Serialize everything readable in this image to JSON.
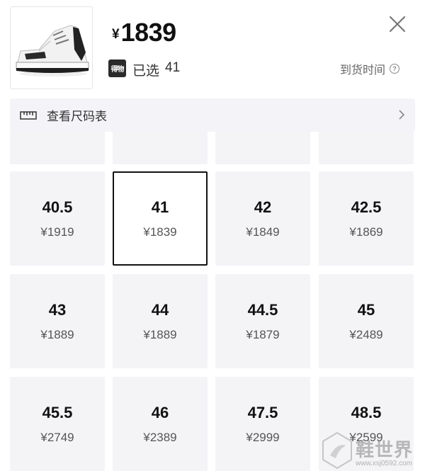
{
  "product": {
    "currency": "¥",
    "price": "1839",
    "badge": "得物",
    "selected_label": "已选",
    "selected_size": "41",
    "arrival_label": "到货时间"
  },
  "size_chart": {
    "label": "查看尺码表"
  },
  "sizes": [
    {
      "size": "40.5",
      "price": "¥1919"
    },
    {
      "size": "41",
      "price": "¥1839",
      "selected": true
    },
    {
      "size": "42",
      "price": "¥1849"
    },
    {
      "size": "42.5",
      "price": "¥1869"
    },
    {
      "size": "43",
      "price": "¥1889"
    },
    {
      "size": "44",
      "price": "¥1889"
    },
    {
      "size": "44.5",
      "price": "¥1879"
    },
    {
      "size": "45",
      "price": "¥2489"
    },
    {
      "size": "45.5",
      "price": "¥2749"
    },
    {
      "size": "46",
      "price": "¥2389"
    },
    {
      "size": "47.5",
      "price": "¥2999"
    },
    {
      "size": "48.5",
      "price": "¥2599"
    }
  ],
  "watermark": {
    "text": "鞋世界",
    "url": "www.xsj0592.com"
  },
  "colors": {
    "selected_border": "#111111",
    "cell_bg": "#f4f4f7",
    "badge_bg": "#2b2b2b"
  }
}
